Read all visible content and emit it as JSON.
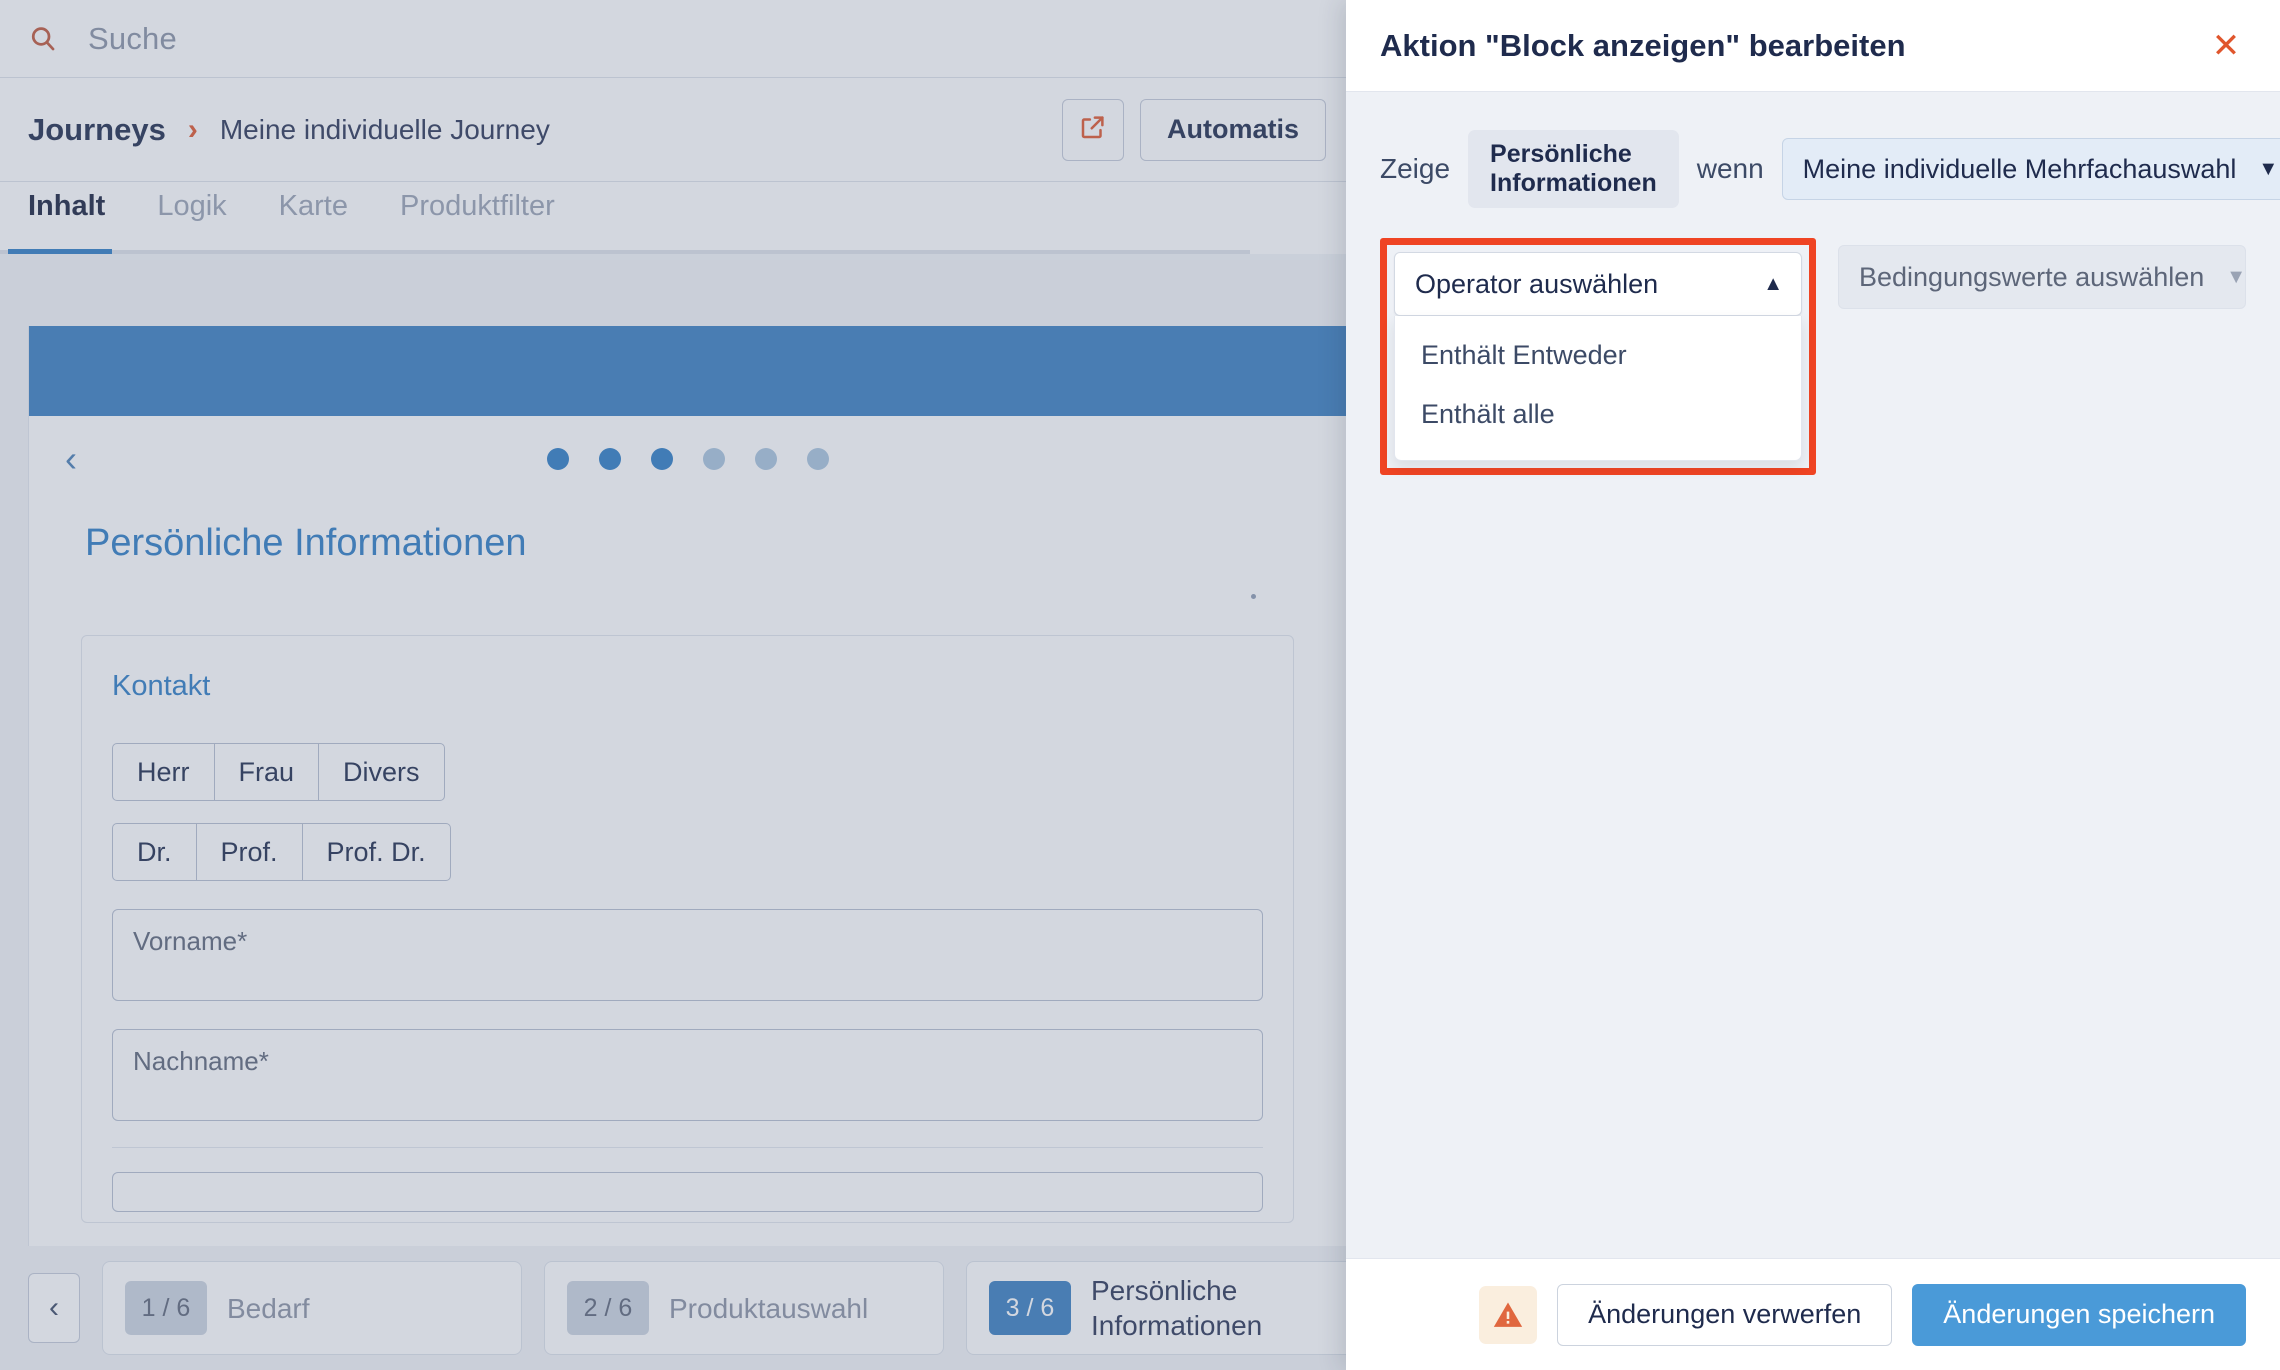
{
  "search": {
    "placeholder": "Suche",
    "icon": "search-icon"
  },
  "breadcrumb": {
    "root": "Journeys",
    "separator": "›",
    "leaf": "Meine individuelle Journey",
    "external_icon": "external-link-icon",
    "automation_button": "Automatis"
  },
  "tabs": [
    {
      "label": "Inhalt",
      "active": true
    },
    {
      "label": "Logik",
      "active": false
    },
    {
      "label": "Karte",
      "active": false
    },
    {
      "label": "Produktfilter",
      "active": false
    }
  ],
  "preview": {
    "back_chevron": "‹",
    "dots_total": 6,
    "dots_active": 3,
    "page_title": "Persönliche Informationen",
    "card": {
      "title": "Kontakt",
      "salutations": [
        "Herr",
        "Frau",
        "Divers"
      ],
      "titles": [
        "Dr.",
        "Prof.",
        "Prof. Dr."
      ],
      "fields": [
        {
          "label": "Vorname",
          "required_mark": "*"
        },
        {
          "label": "Nachname",
          "required_mark": "*"
        }
      ]
    }
  },
  "steps": {
    "prev_icon": "chevron-left-icon",
    "items": [
      {
        "badge": "1 / 6",
        "label": "Bedarf",
        "active": false
      },
      {
        "badge": "2 / 6",
        "label": "Produktauswahl",
        "active": false
      },
      {
        "badge": "3 / 6",
        "label": "Persönliche Informationen",
        "active": true
      }
    ]
  },
  "drawer": {
    "title": "Aktion \"Block anzeigen\" bearbeiten",
    "close_icon": "close-icon",
    "condition": {
      "show_word": "Zeige",
      "target_chip": "Persönliche Informationen",
      "when_word": "wenn",
      "source_select": {
        "value": "Meine individuelle Mehrfachauswahl",
        "caret": "▼"
      },
      "operator_select": {
        "value": "Operator auswählen",
        "caret": "▲",
        "expanded": true,
        "options": [
          "Enthält Entweder",
          "Enthält alle"
        ]
      },
      "values_select": {
        "value": "Bedingungswerte auswählen",
        "caret": "▼",
        "disabled": true
      }
    },
    "footer": {
      "warning_icon": "warning-triangle-icon",
      "discard_label": "Änderungen verwerfen",
      "save_label": "Änderungen speichern"
    }
  },
  "colors": {
    "accent_orange": "#e0562d",
    "accent_blue": "#2f7dc4",
    "highlight_red": "#ef4423",
    "primary_button": "#4a9ad8"
  }
}
